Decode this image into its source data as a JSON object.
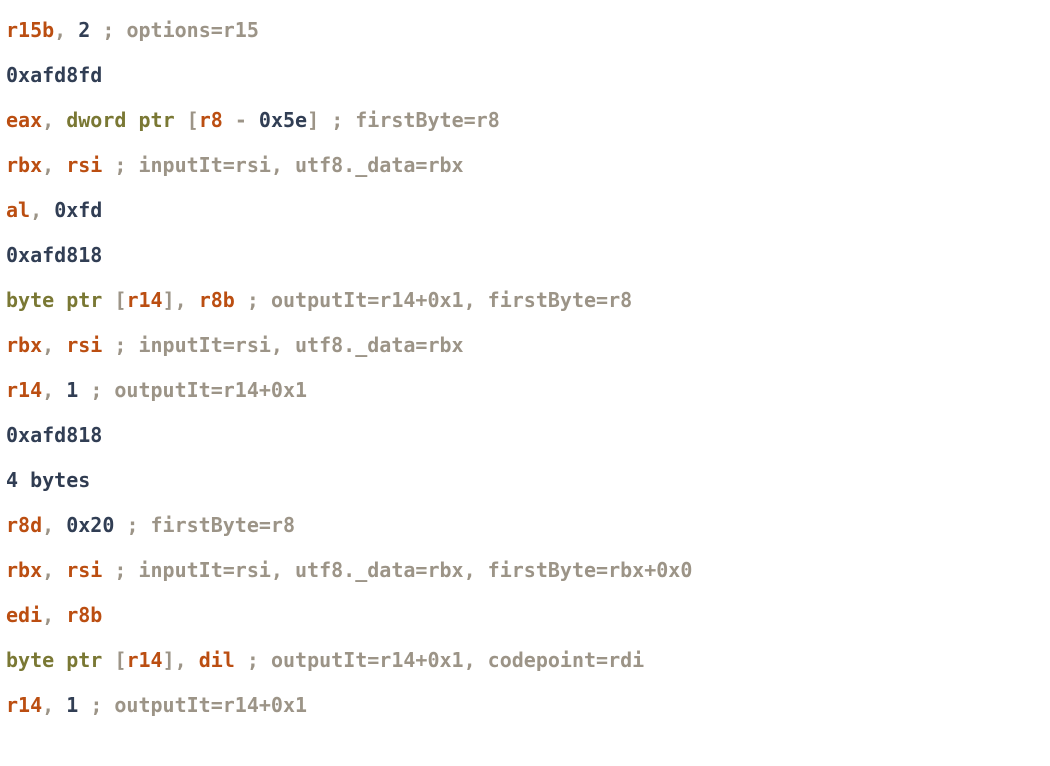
{
  "lines": [
    {
      "tokens": [
        {
          "cls": "reg",
          "t": "r15b"
        },
        {
          "cls": "p",
          "t": ", "
        },
        {
          "cls": "num",
          "t": "2"
        },
        {
          "cls": "p",
          "t": " "
        },
        {
          "cls": "cm",
          "t": "; options=r15"
        }
      ]
    },
    {
      "tokens": [
        {
          "cls": "num",
          "t": "0xafd8fd"
        }
      ]
    },
    {
      "tokens": [
        {
          "cls": "reg",
          "t": "eax"
        },
        {
          "cls": "p",
          "t": ", "
        },
        {
          "cls": "kw",
          "t": "dword"
        },
        {
          "cls": "p",
          "t": " "
        },
        {
          "cls": "kw",
          "t": "ptr"
        },
        {
          "cls": "p",
          "t": " ["
        },
        {
          "cls": "reg",
          "t": "r8"
        },
        {
          "cls": "p",
          "t": " - "
        },
        {
          "cls": "num",
          "t": "0x5e"
        },
        {
          "cls": "p",
          "t": "] "
        },
        {
          "cls": "cm",
          "t": "; firstByte=r8"
        }
      ]
    },
    {
      "tokens": [
        {
          "cls": "reg",
          "t": "rbx"
        },
        {
          "cls": "p",
          "t": ", "
        },
        {
          "cls": "reg",
          "t": "rsi"
        },
        {
          "cls": "p",
          "t": " "
        },
        {
          "cls": "cm",
          "t": "; inputIt=rsi, utf8._data=rbx"
        }
      ]
    },
    {
      "tokens": [
        {
          "cls": "reg",
          "t": "al"
        },
        {
          "cls": "p",
          "t": ", "
        },
        {
          "cls": "num",
          "t": "0xfd"
        }
      ]
    },
    {
      "tokens": [
        {
          "cls": "num",
          "t": "0xafd818"
        }
      ]
    },
    {
      "tokens": [
        {
          "cls": "kw",
          "t": "byte"
        },
        {
          "cls": "p",
          "t": " "
        },
        {
          "cls": "kw",
          "t": "ptr"
        },
        {
          "cls": "p",
          "t": " ["
        },
        {
          "cls": "reg",
          "t": "r14"
        },
        {
          "cls": "p",
          "t": "], "
        },
        {
          "cls": "reg",
          "t": "r8b"
        },
        {
          "cls": "p",
          "t": " "
        },
        {
          "cls": "cm",
          "t": "; outputIt=r14+0x1, firstByte=r8"
        }
      ]
    },
    {
      "tokens": [
        {
          "cls": "reg",
          "t": "rbx"
        },
        {
          "cls": "p",
          "t": ", "
        },
        {
          "cls": "reg",
          "t": "rsi"
        },
        {
          "cls": "p",
          "t": " "
        },
        {
          "cls": "cm",
          "t": "; inputIt=rsi, utf8._data=rbx"
        }
      ]
    },
    {
      "tokens": [
        {
          "cls": "reg",
          "t": "r14"
        },
        {
          "cls": "p",
          "t": ", "
        },
        {
          "cls": "num",
          "t": "1"
        },
        {
          "cls": "p",
          "t": " "
        },
        {
          "cls": "cm",
          "t": "; outputIt=r14+0x1"
        }
      ]
    },
    {
      "tokens": [
        {
          "cls": "num",
          "t": "0xafd818"
        }
      ]
    },
    {
      "tokens": [
        {
          "cls": "num",
          "t": "4"
        },
        {
          "cls": "p",
          "t": " "
        },
        {
          "cls": "by",
          "t": "bytes"
        }
      ]
    },
    {
      "tokens": [
        {
          "cls": "reg",
          "t": "r8d"
        },
        {
          "cls": "p",
          "t": ", "
        },
        {
          "cls": "num",
          "t": "0x20"
        },
        {
          "cls": "p",
          "t": " "
        },
        {
          "cls": "cm",
          "t": "; firstByte=r8"
        }
      ]
    },
    {
      "tokens": [
        {
          "cls": "reg",
          "t": "rbx"
        },
        {
          "cls": "p",
          "t": ", "
        },
        {
          "cls": "reg",
          "t": "rsi"
        },
        {
          "cls": "p",
          "t": " "
        },
        {
          "cls": "cm",
          "t": "; inputIt=rsi, utf8._data=rbx, firstByte=rbx+0x0"
        }
      ]
    },
    {
      "tokens": [
        {
          "cls": "reg",
          "t": "edi"
        },
        {
          "cls": "p",
          "t": ", "
        },
        {
          "cls": "reg",
          "t": "r8b"
        }
      ]
    },
    {
      "tokens": [
        {
          "cls": "kw",
          "t": "byte"
        },
        {
          "cls": "p",
          "t": " "
        },
        {
          "cls": "kw",
          "t": "ptr"
        },
        {
          "cls": "p",
          "t": " ["
        },
        {
          "cls": "reg",
          "t": "r14"
        },
        {
          "cls": "p",
          "t": "], "
        },
        {
          "cls": "reg",
          "t": "dil"
        },
        {
          "cls": "p",
          "t": " "
        },
        {
          "cls": "cm",
          "t": "; outputIt=r14+0x1, codepoint=rdi"
        }
      ]
    },
    {
      "tokens": [
        {
          "cls": "reg",
          "t": "r14"
        },
        {
          "cls": "p",
          "t": ", "
        },
        {
          "cls": "num",
          "t": "1"
        },
        {
          "cls": "p",
          "t": " "
        },
        {
          "cls": "cm",
          "t": "; outputIt=r14+0x1"
        }
      ]
    }
  ]
}
